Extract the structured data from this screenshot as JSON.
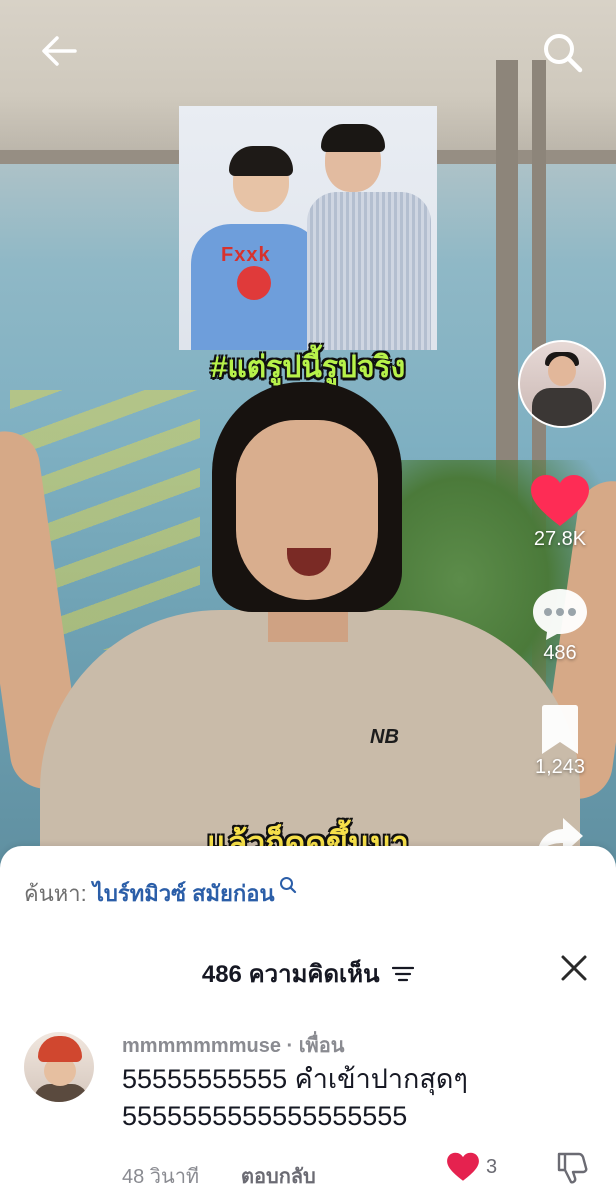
{
  "video": {
    "caption_top": "#แต่รูปนี้รูปจริง",
    "caption_bottom": "แล้วก็ดูดขึ้นมา",
    "photo_card_text": "Fxxk"
  },
  "topbar": {
    "back_icon": "arrow-left-icon",
    "search_icon": "search-icon"
  },
  "rail": {
    "likes": "27.8K",
    "comments": "486",
    "saves": "1,243",
    "like_color": "#fe2c55"
  },
  "sheet": {
    "search_prefix": "ค้นหา:",
    "search_query": "ไบร์ทมิวซ์ สมัยก่อน",
    "title": "486 ความคิดเห็น",
    "comment": {
      "username": "mmmmmmmuse · เพื่อน",
      "text": "55555555555 คำเข้าปากสุดๆ 5555555555555555555",
      "time": "48 วินาที",
      "reply_label": "ตอบกลับ",
      "like_count": "3",
      "like_color": "#e5224f"
    }
  }
}
